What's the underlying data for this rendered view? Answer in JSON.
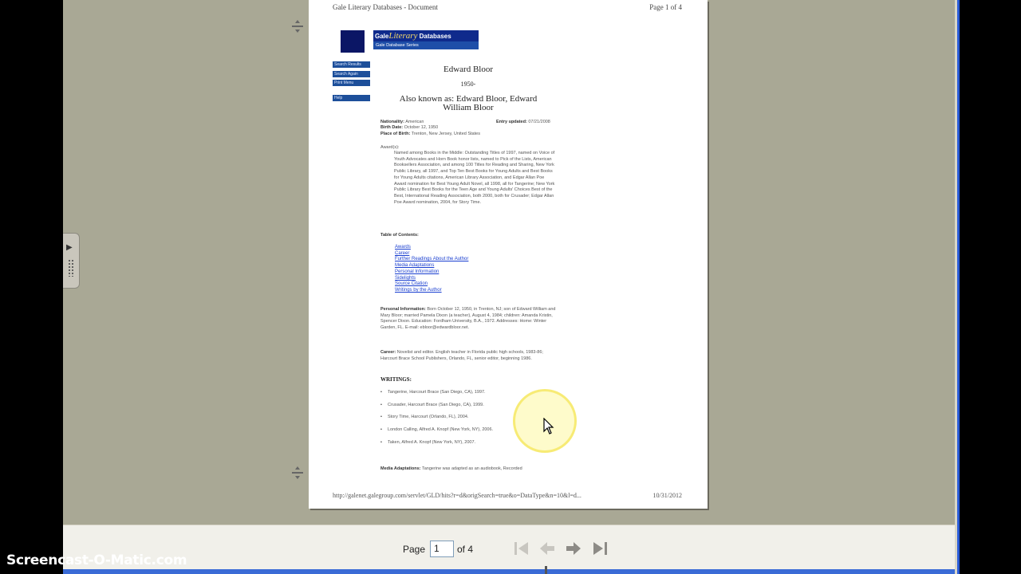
{
  "page": {
    "header_left": "Gale Literary Databases - Document",
    "header_right": "Page 1 of 4",
    "logo_brand": "Gale",
    "logo_word": "Literary",
    "logo_tail": "Databases",
    "logo_sub": "Gale Database Series",
    "nav_buttons": [
      "Search Results",
      "Search Again",
      "Print Menu",
      "Help"
    ],
    "title": "Edward Bloor",
    "birth_year": "1950-",
    "aka": "Also known as: Edward Bloor, Edward William Bloor",
    "nationality_label": "Nationality:",
    "nationality": "American",
    "entry_updated_label": "Entry updated:",
    "entry_updated": "07/21/2008",
    "birth_date_label": "Birth Date:",
    "birth_date": "October 12, 1950",
    "birth_place_label": "Place of Birth:",
    "birth_place": "Trenton, New Jersey, United States",
    "awards_label": "Award(s):",
    "awards_text": "Named among Books in the Middle: Outstanding Titles of 1997, named on Voice of Youth Advocates and Horn Book honor lists, named to Pick of the Lists, American Booksellers Association, and among 100 Titles for Reading and Sharing, New York Public Library, all 1997, and Top Ten Best Books for Young Adults and Best Books for Young Adults citations, American Library Association, and Edgar Allan Poe Award nomination for Best Young Adult Novel, all 1998, all for Tangerine; New York Public Library Best Books for the Teen Age and Young Adults' Choices Best of the Best, International Reading Association, both 2000, both for Crusader; Edgar Allan Poe Award nomination, 2004, for Story Time.",
    "toc_label": "Table of Contents:",
    "toc_links": [
      "Awards",
      "Career",
      "Further Readings About the Author",
      "Media Adaptations",
      "Personal Information",
      "Sidelights",
      "Source Citation",
      "Writings by the Author"
    ],
    "personal_label": "Personal Information:",
    "personal_text": "Born October 12, 1950, in Trenton, NJ; son of Edward William and Mary Bloor; married Pamela Dixon (a teacher), August 4, 1984; children: Amanda Kristin, Spencer Dixon. Education: Fordham University, B.A., 1972. Addresses: Home: Winter Garden, FL. E-mail: ebloor@edwardbloor.net.",
    "career_label": "Career:",
    "career_text": "Novelist and editor. English teacher in Florida public high schools, 1983-86; Harcourt Brace School Publishers, Orlando, FL, senior editor, beginning 1986.",
    "writings_label": "WRITINGS:",
    "writings": [
      "Tangerine, Harcourt Brace (San Diego, CA), 1997.",
      "Crusader, Harcourt Brace (San Diego, CA), 1999.",
      "Story Time, Harcourt (Orlando, FL), 2004.",
      "London Calling, Alfred A. Knopf (New York, NY), 2006.",
      "Taken, Alfred A. Knopf (New York, NY), 2007."
    ],
    "media_label": "Media Adaptations:",
    "media_text": "Tangerine was adapted as an audiobook, Recorded",
    "footer_left": "http://galenet.galegroup.com/servlet/GLD/hits?r=d&origSearch=true&o=DataType&n=10&l=d...",
    "footer_right": "10/31/2012"
  },
  "nav": {
    "page_label": "Page",
    "page_value": "1",
    "of_label": "of 4",
    "icons": [
      "first-page-icon",
      "previous-page-icon",
      "next-page-icon",
      "last-page-icon"
    ]
  },
  "watermark": "Screencast-O-Matic.com",
  "colors": {
    "viewer_bg": "#a9a895",
    "nav_bg": "#f1f0ea",
    "link": "#1a3fd0",
    "highlight": "#f5e65a"
  }
}
